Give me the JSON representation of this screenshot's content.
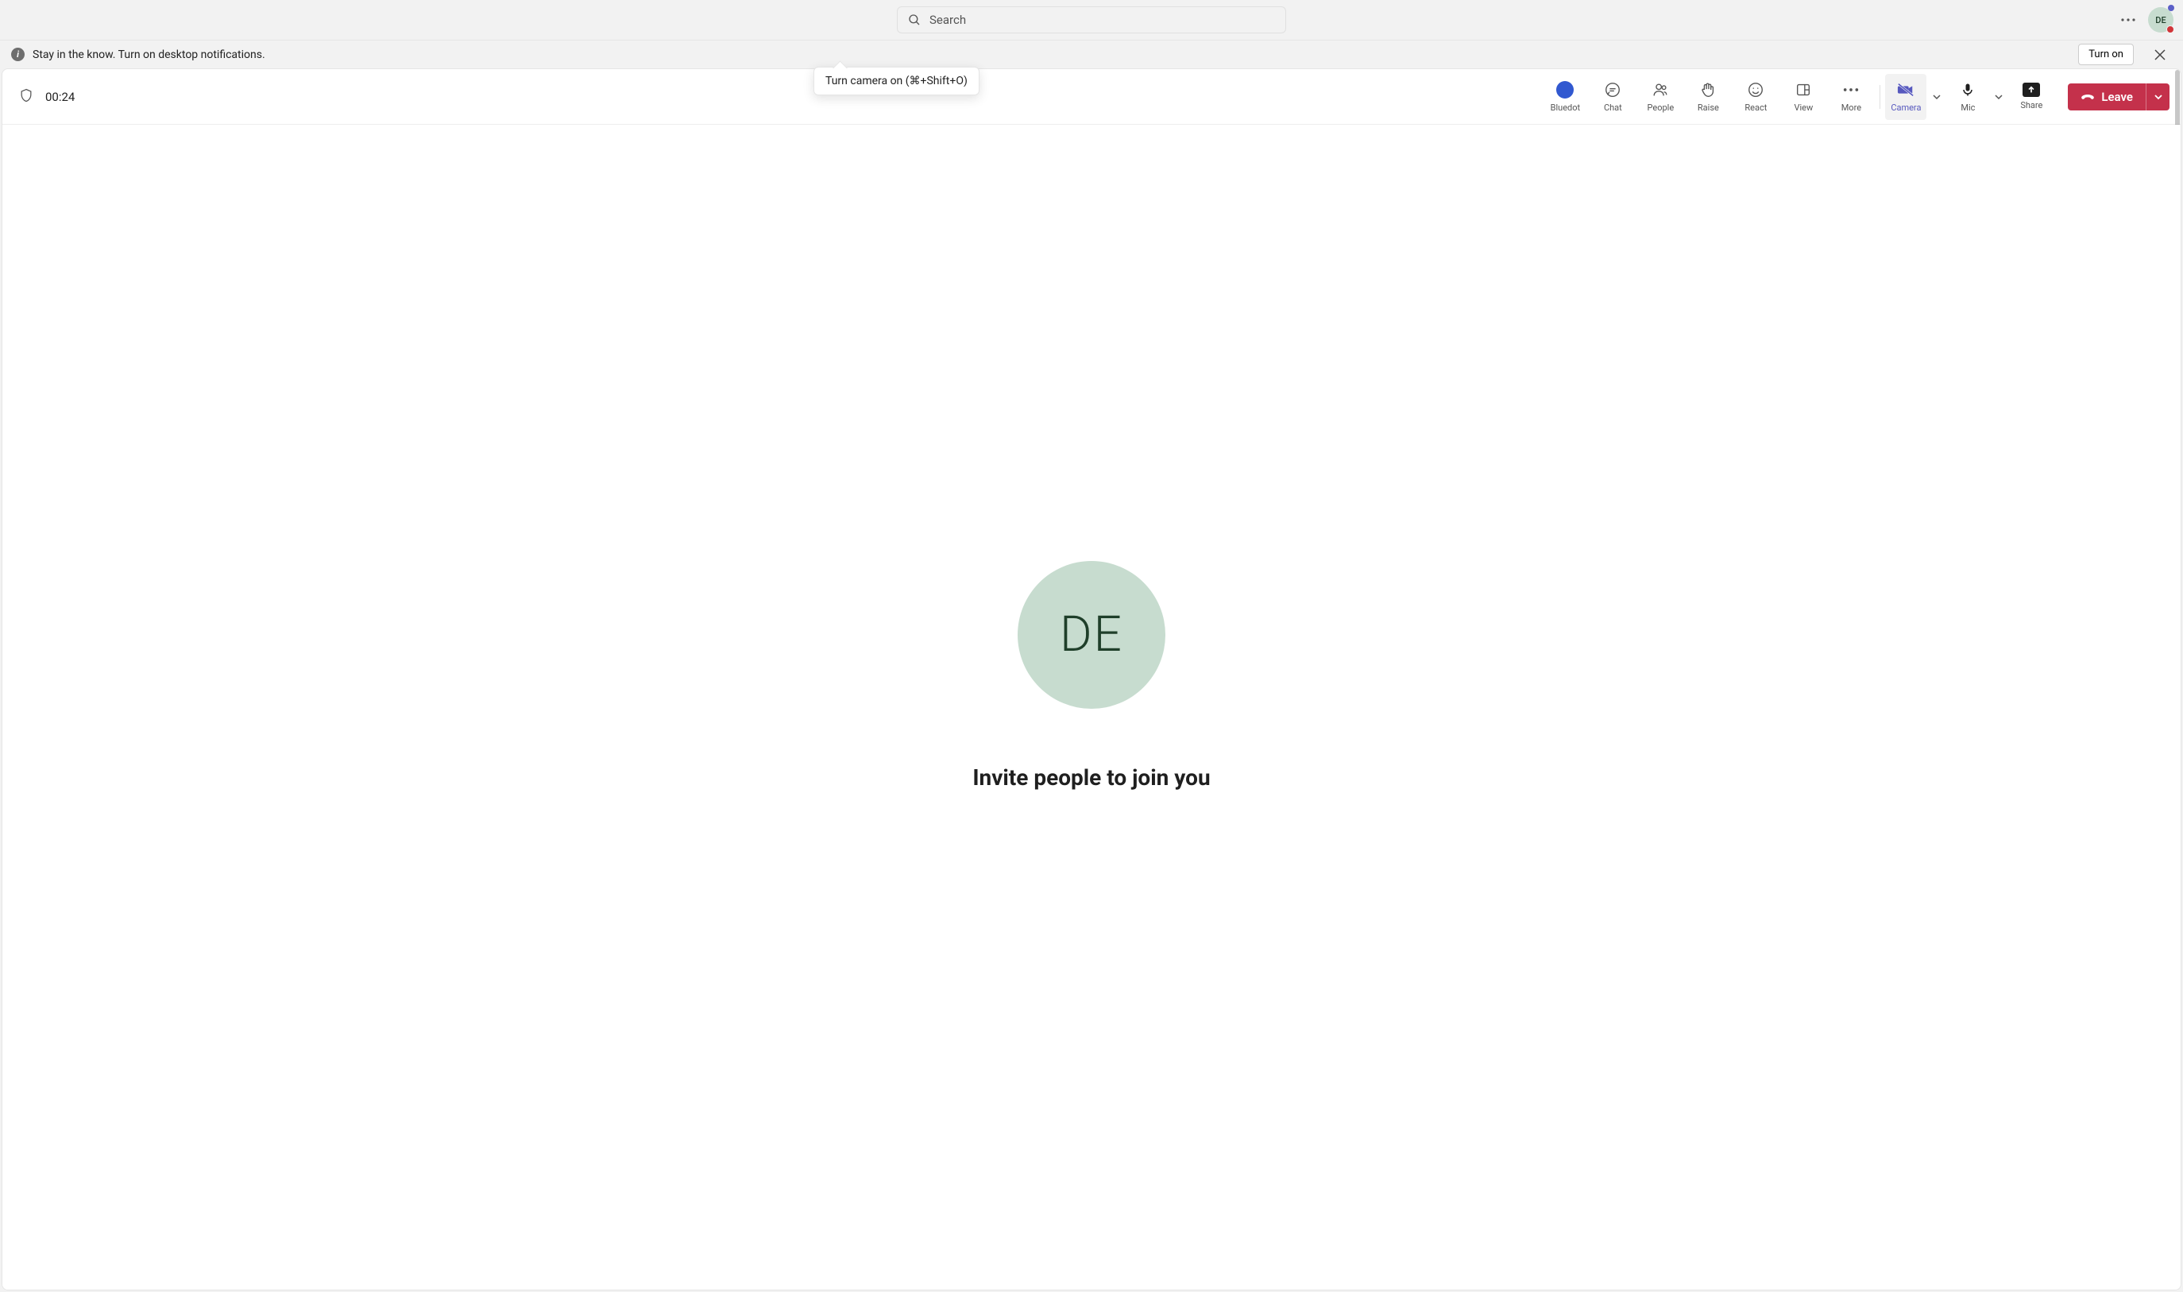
{
  "header": {
    "search_placeholder": "Search",
    "avatar_initials": "DE"
  },
  "notification": {
    "message": "Stay in the know. Turn on desktop notifications.",
    "turn_on_label": "Turn on"
  },
  "meeting": {
    "timer": "00:24",
    "tooltip": "Turn camera on (⌘+Shift+O)",
    "toolbar": {
      "bluedot": "Bluedot",
      "chat": "Chat",
      "people": "People",
      "raise": "Raise",
      "react": "React",
      "view": "View",
      "more": "More",
      "camera": "Camera",
      "mic": "Mic",
      "share": "Share",
      "leave": "Leave"
    },
    "stage": {
      "avatar_initials": "DE",
      "invite_text": "Invite people to join you"
    }
  },
  "colors": {
    "leave": "#c4314b",
    "bluedot": "#3158d0",
    "accent": "#5658be",
    "avatar_bg": "#c7dccf",
    "avatar_fg": "#1f3f2a"
  }
}
